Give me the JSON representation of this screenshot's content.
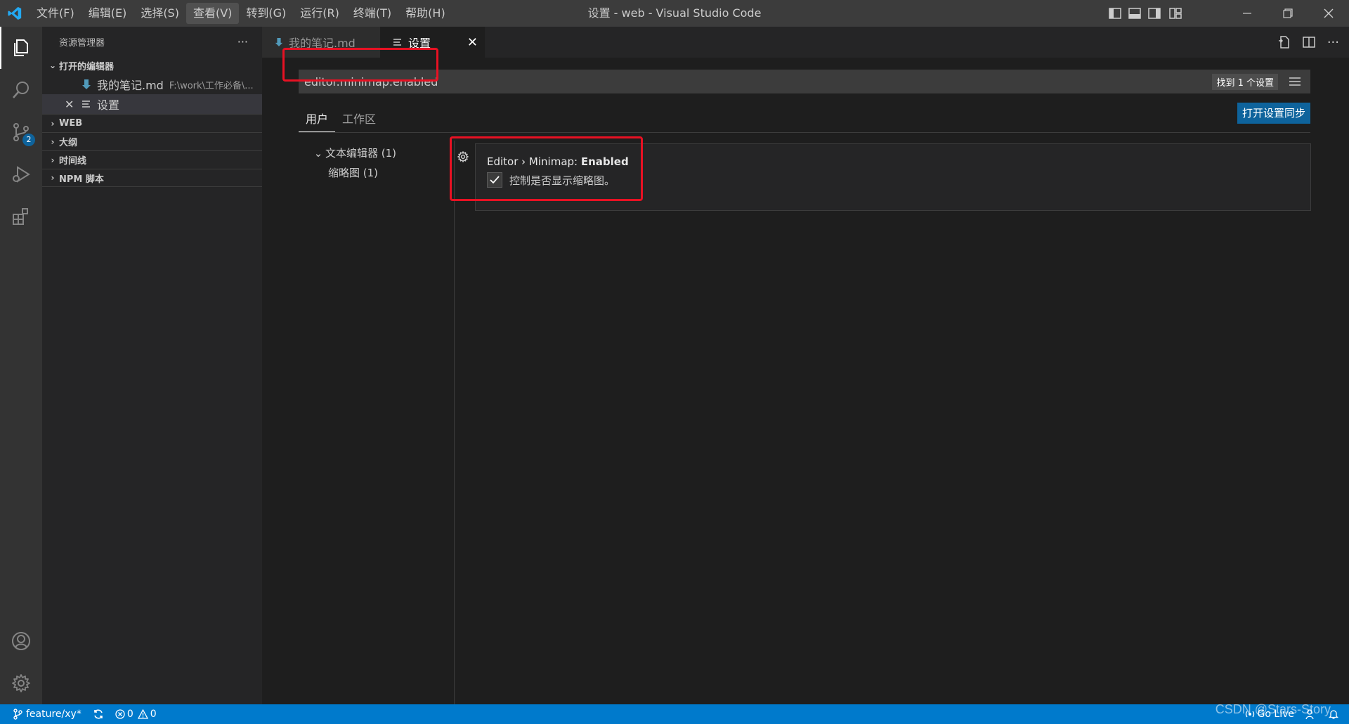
{
  "window": {
    "title": "设置 - web - Visual Studio Code"
  },
  "menu": [
    "文件(F)",
    "编辑(E)",
    "选择(S)",
    "查看(V)",
    "转到(G)",
    "运行(R)",
    "终端(T)",
    "帮助(H)"
  ],
  "menu_active": "查看(V)",
  "activity": {
    "scm_badge": "2"
  },
  "sidebar": {
    "title": "资源管理器",
    "more": "···",
    "open_editors": {
      "label": "打开的编辑器",
      "items": [
        {
          "name": "我的笔记.md",
          "path": "F:\\work\\工作必备\\..."
        },
        {
          "name": "设置",
          "path": ""
        }
      ]
    },
    "sections": [
      "WEB",
      "大纲",
      "时间线",
      "NPM 脚本"
    ]
  },
  "tabs": [
    {
      "label": "我的笔记.md",
      "icon": "markdown-icon"
    },
    {
      "label": "设置",
      "icon": "settings-file-icon"
    }
  ],
  "settings": {
    "search_value": "editor.minimap.enabled",
    "result_count": "找到 1 个设置",
    "scope_tabs": [
      "用户",
      "工作区"
    ],
    "sync_button": "打开设置同步",
    "toc": [
      {
        "label": "文本编辑器 (1)",
        "expanded": true
      },
      {
        "label": "缩略图 (1)"
      }
    ],
    "item": {
      "category": "Editor › Minimap: ",
      "name": "Enabled",
      "description": "控制是否显示缩略图。",
      "checked": true
    }
  },
  "statusbar": {
    "branch": "feature/xy*",
    "errors": "0",
    "warnings": "0",
    "go_live": "Go Live"
  },
  "watermark": "CSDN @Stars-Story",
  "colors": {
    "accent": "#007acc",
    "highlight": "#e81123",
    "button": "#0e639c"
  }
}
